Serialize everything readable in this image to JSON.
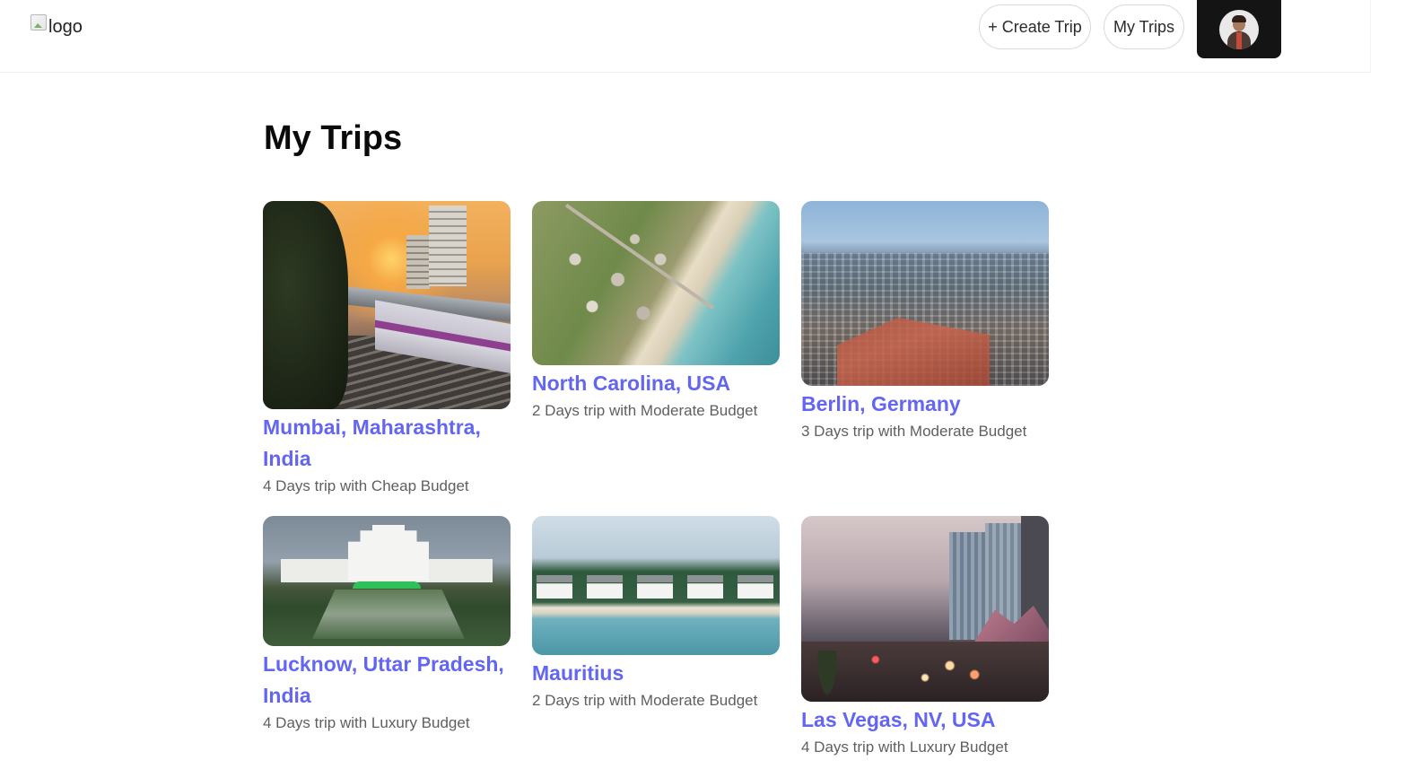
{
  "header": {
    "logo_alt": "logo",
    "create_trip_label": "+ Create Trip",
    "my_trips_label": "My Trips"
  },
  "main": {
    "title": "My Trips",
    "trips": [
      {
        "destination": "Mumbai, Maharashtra, India",
        "summary": "4 Days trip with Cheap Budget"
      },
      {
        "destination": "North Carolina, USA",
        "summary": "2 Days trip with Moderate Budget"
      },
      {
        "destination": "Berlin, Germany",
        "summary": "3 Days trip with Moderate Budget"
      },
      {
        "destination": "Lucknow, Uttar Pradesh, India",
        "summary": "4 Days trip with Luxury Budget"
      },
      {
        "destination": "Mauritius",
        "summary": "2 Days trip with Moderate Budget"
      },
      {
        "destination": "Las Vegas, NV, USA",
        "summary": "4 Days trip with Luxury Budget"
      }
    ]
  },
  "colors": {
    "accent": "#6366f1",
    "account_button_bg": "#141414"
  }
}
